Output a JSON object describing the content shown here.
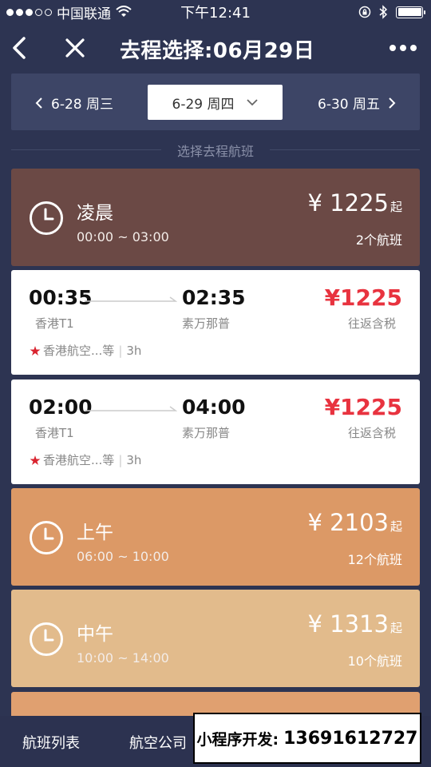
{
  "status_bar": {
    "carrier": "中国联通",
    "time": "下午12:41"
  },
  "nav": {
    "title": "去程选择:06月29日"
  },
  "date_bar": {
    "prev": "6-28 周三",
    "current": "6-29 周四",
    "next": "6-30 周五"
  },
  "section_label": "选择去程航班",
  "periods": [
    {
      "name": "凌晨",
      "range": "00:00 ~ 03:00",
      "price": "¥ 1225",
      "suffix": "起",
      "count": "2个航班",
      "color": "#6b4945"
    },
    {
      "name": "上午",
      "range": "06:00 ~ 10:00",
      "price": "¥ 2103",
      "suffix": "起",
      "count": "12个航班",
      "color": "#dc9966"
    },
    {
      "name": "中午",
      "range": "10:00 ~ 14:00",
      "price": "¥ 1313",
      "suffix": "起",
      "count": "10个航班",
      "color": "#e2bb8c"
    }
  ],
  "flights": [
    {
      "dep_time": "00:35",
      "arr_time": "02:35",
      "dep_airport": "香港T1",
      "arr_airport": "素万那普",
      "price": "¥1225",
      "tax_note": "往返含税",
      "airline": "香港航空...等",
      "duration": "3h"
    },
    {
      "dep_time": "02:00",
      "arr_time": "04:00",
      "dep_airport": "香港T1",
      "arr_airport": "素万那普",
      "price": "¥1225",
      "tax_note": "往返含税",
      "airline": "香港航空...等",
      "duration": "3h"
    }
  ],
  "bottom_tabs": [
    "航班列表",
    "航空公司"
  ],
  "ad": {
    "label": "小程序开发:",
    "phone": "13691612727"
  },
  "colors": {
    "background": "#2d3452",
    "date_bar": "#3d4566",
    "price_red": "#e8333f"
  }
}
